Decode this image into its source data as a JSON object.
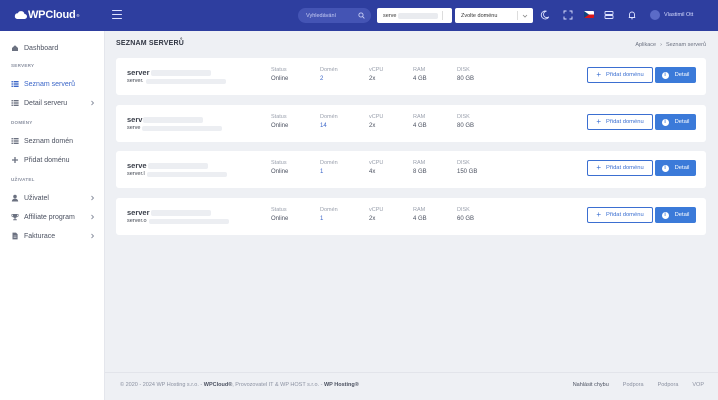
{
  "brand": {
    "name": "WPCloud",
    "mark": "®"
  },
  "topbar": {
    "search_placeholder": "Vyhledávání",
    "server_select_value": "serve",
    "domain_select_value": "Zvolte doménu",
    "user_name": "Vlastimil Ott"
  },
  "sidebar": {
    "items": [
      {
        "label": "Dashboard"
      },
      {
        "label": "Seznam serverů"
      },
      {
        "label": "Detail serveru"
      },
      {
        "label": "Seznam domén"
      },
      {
        "label": "Přidat doménu"
      },
      {
        "label": "Uživatel"
      },
      {
        "label": "Affiliate program"
      },
      {
        "label": "Fakturace"
      }
    ],
    "sections": [
      "SERVERY",
      "DOMÉNY",
      "UŽIVATEL"
    ]
  },
  "page": {
    "title": "SEZNAM SERVERŮ",
    "breadcrumb": [
      "Aplikace",
      "›",
      "Seznam serverů"
    ]
  },
  "columns": {
    "status": "Status",
    "domains": "Domén",
    "vcpu": "vCPU",
    "ram": "RAM",
    "disk": "DISK"
  },
  "buttons": {
    "add_domain": "Přidat doménu",
    "detail": "Detail"
  },
  "servers": [
    {
      "name": "server",
      "host": "server.",
      "status": "Online",
      "domains": "2",
      "vcpu": "2x",
      "ram": "4 GB",
      "disk": "80 GB"
    },
    {
      "name": "serv",
      "host": "serve",
      "status": "Online",
      "domains": "14",
      "vcpu": "2x",
      "ram": "4 GB",
      "disk": "80 GB"
    },
    {
      "name": "serve",
      "host": "server.l",
      "status": "Online",
      "domains": "1",
      "vcpu": "4x",
      "ram": "8 GB",
      "disk": "150 GB"
    },
    {
      "name": "server",
      "host": "server.o",
      "status": "Online",
      "domains": "1",
      "vcpu": "2x",
      "ram": "4 GB",
      "disk": "60 GB"
    }
  ],
  "footer": {
    "copy_prefix": "© 2020 - 2024 WP Hosting s.r.o. -",
    "copy_brand": "WPCloud®",
    "copy_mid": ", Provozovatel IT & WP HOST s.r.o. -",
    "copy_end": "WP Hosting®",
    "links": [
      "Nahlásit chybu",
      "Podpora",
      "Podpora",
      "VOP"
    ]
  }
}
